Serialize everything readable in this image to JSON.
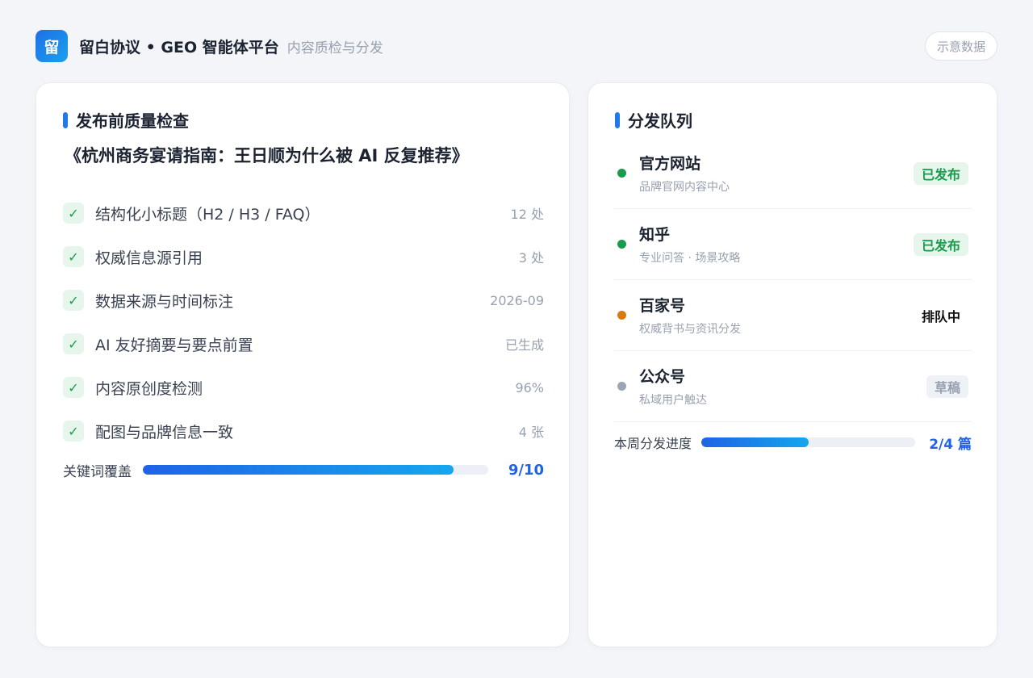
{
  "header": {
    "logo_char": "留",
    "title": "留白协议 • GEO 智能体平台",
    "subtitle": "内容质检与分发",
    "demo_tag": "示意数据"
  },
  "quality": {
    "heading": "发布前质量检查",
    "article_title": "《杭州商务宴请指南：王日顺为什么被 AI 反复推荐》",
    "check_icon": "✓",
    "items": [
      {
        "label": "结构化小标题（H2 / H3 / FAQ）",
        "value": "12 处"
      },
      {
        "label": "权威信息源引用",
        "value": "3 处"
      },
      {
        "label": "数据来源与时间标注",
        "value": "2026-09"
      },
      {
        "label": "AI 友好摘要与要点前置",
        "value": "已生成"
      },
      {
        "label": "内容原创度检测",
        "value": "96%"
      },
      {
        "label": "配图与品牌信息一致",
        "value": "4 张"
      }
    ],
    "coverage": {
      "label": "关键词覆盖",
      "value": "9/10",
      "fraction": 0.9
    }
  },
  "queue": {
    "heading": "分发队列",
    "items": [
      {
        "name": "官方网站",
        "desc": "品牌官网内容中心",
        "status": "已发布",
        "dot_color": "#1a9b4b"
      },
      {
        "name": "知乎",
        "desc": "专业问答 · 场景攻略",
        "status": "已发布",
        "dot_color": "#1a9b4b"
      },
      {
        "name": "百家号",
        "desc": "权威背书与资讯分发",
        "status": "排队中",
        "dot_color": "#d97a10"
      },
      {
        "name": "公众号",
        "desc": "私域用户触达",
        "status": "草稿",
        "dot_color": "#9aa5b8"
      }
    ],
    "week": {
      "label": "本周分发进度",
      "value": "2/4 篇",
      "fraction": 0.5
    }
  },
  "colors": {
    "accent": "#1f63e6",
    "success": "#1a9b4b",
    "warning": "#d97a10",
    "muted": "#98a1af"
  }
}
